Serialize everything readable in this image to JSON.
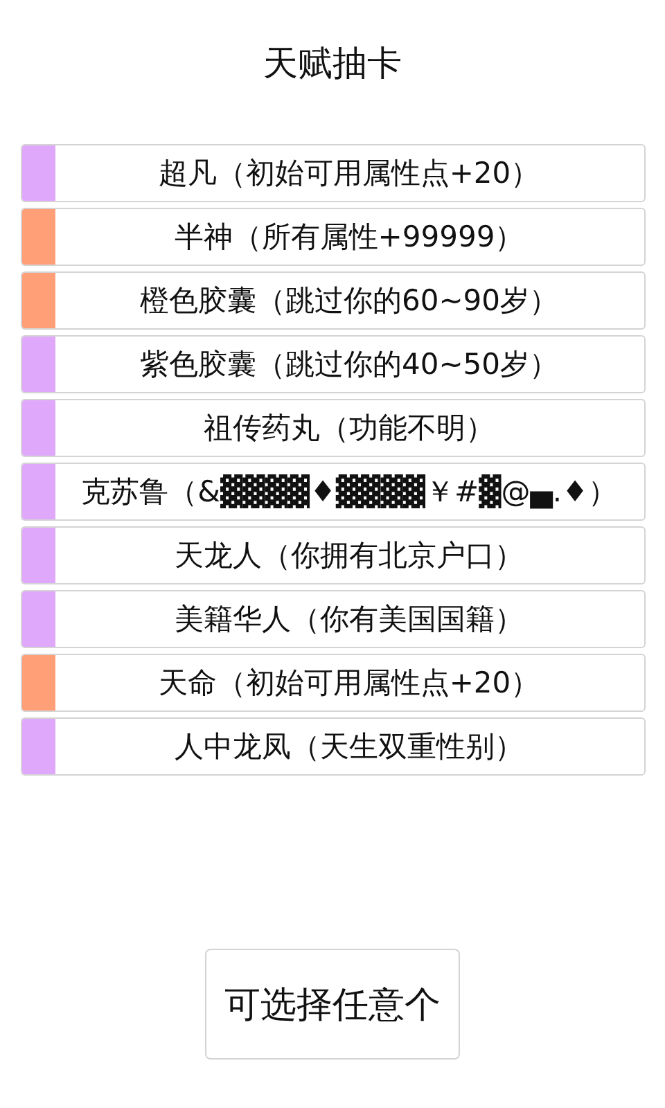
{
  "title": "天赋抽卡",
  "talents": [
    {
      "label": "超凡（初始可用属性点+20）",
      "color": "#e0a8fa"
    },
    {
      "label": "半神（所有属性+99999）",
      "color": "#ff9f78"
    },
    {
      "label": "橙色胶囊（跳过你的60~90岁）",
      "color": "#ff9f78"
    },
    {
      "label": "紫色胶囊（跳过你的40~50岁）",
      "color": "#e0a8fa"
    },
    {
      "label": "祖传药丸（功能不明）",
      "color": "#e0a8fa"
    },
    {
      "label": "克苏鲁（&▓▓▓▓♦▓▓▓▓￥#▓@▄.♦）",
      "color": "#e0a8fa"
    },
    {
      "label": "天龙人（你拥有北京户口）",
      "color": "#e0a8fa"
    },
    {
      "label": "美籍华人（你有美国国籍）",
      "color": "#e0a8fa"
    },
    {
      "label": "天命（初始可用属性点+20）",
      "color": "#ff9f78"
    },
    {
      "label": "人中龙凤（天生双重性别）",
      "color": "#e0a8fa"
    }
  ],
  "button": "可选择任意个"
}
